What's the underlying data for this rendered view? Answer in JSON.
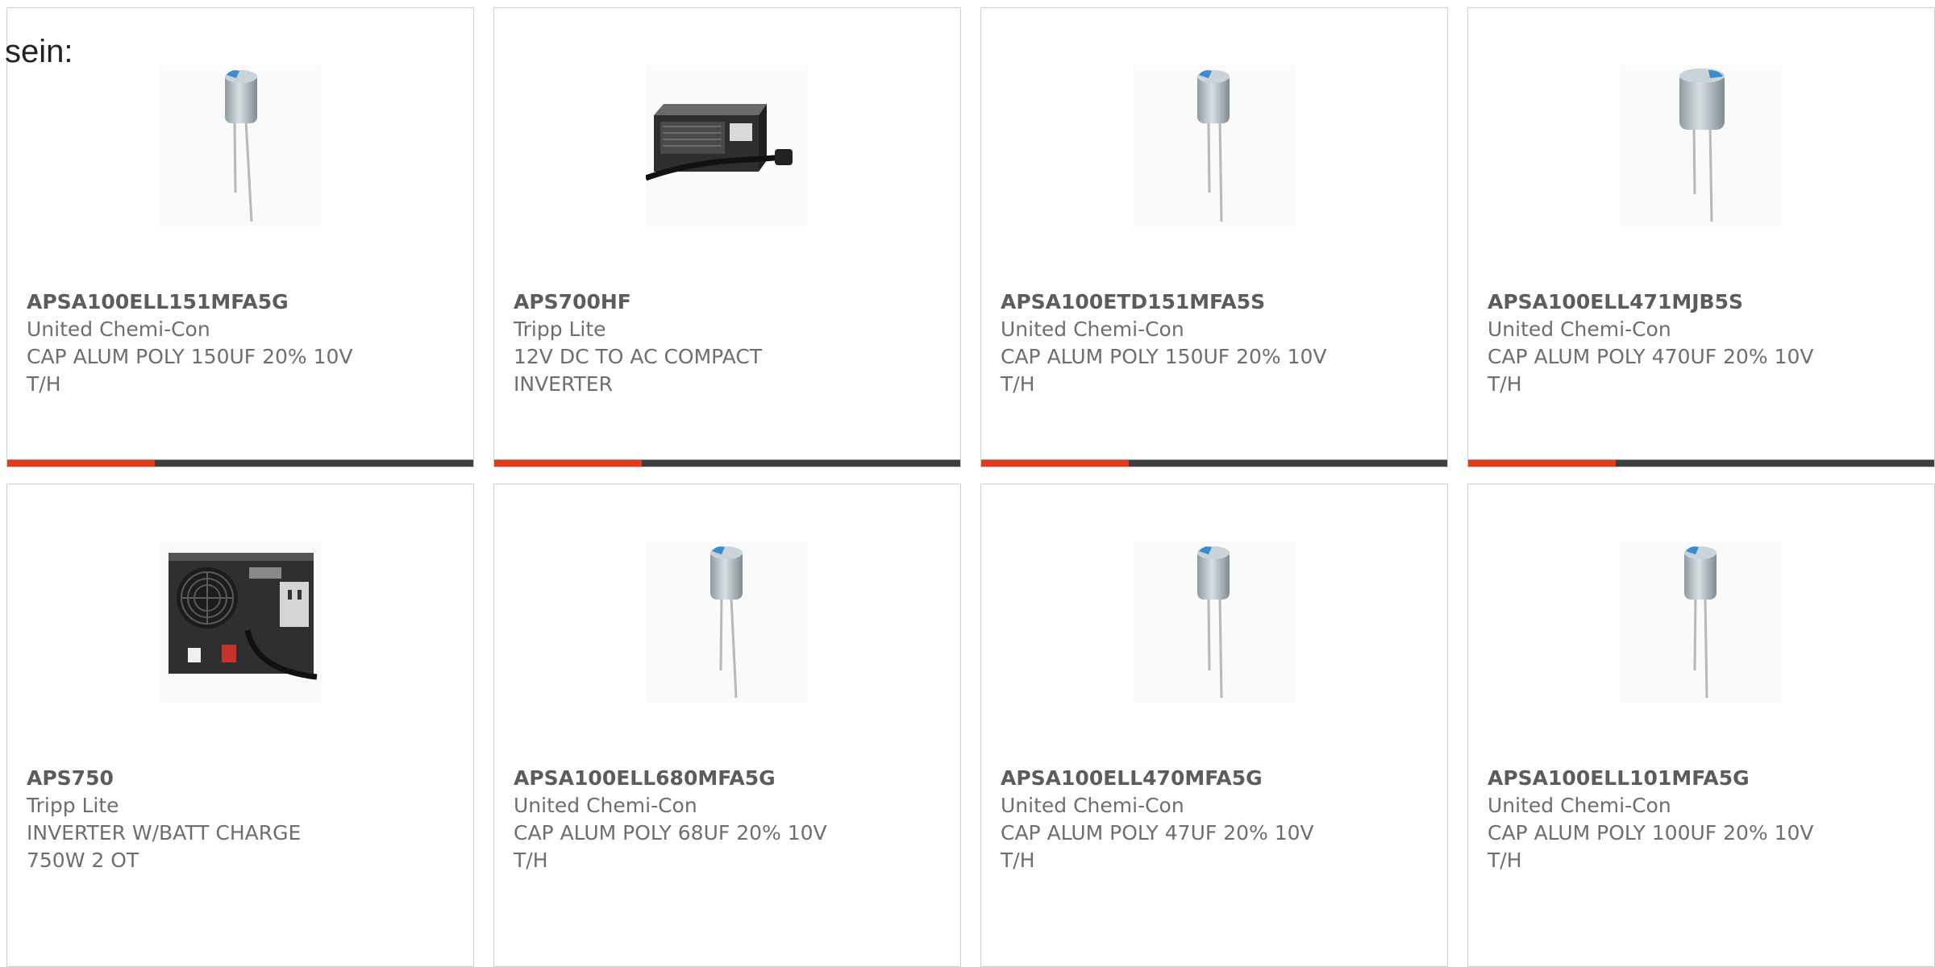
{
  "page": {
    "prefix_text": "sein:"
  },
  "products": [
    {
      "part": "APSA100ELL151MFA5G",
      "maker": "United Chemi-Con",
      "desc1": "CAP ALUM POLY 150UF 20% 10V",
      "desc2": "T/H",
      "image": "capacitor-image"
    },
    {
      "part": "APS700HF",
      "maker": "Tripp Lite",
      "desc1": "12V DC TO AC COMPACT",
      "desc2": "INVERTER",
      "image": "inverter-image"
    },
    {
      "part": "APSA100ETD151MFA5S",
      "maker": "United Chemi-Con",
      "desc1": "CAP ALUM POLY 150UF 20% 10V",
      "desc2": "T/H",
      "image": "capacitor-image"
    },
    {
      "part": "APSA100ELL471MJB5S",
      "maker": "United Chemi-Con",
      "desc1": "CAP ALUM POLY 470UF 20% 10V",
      "desc2": "T/H",
      "image": "capacitor-image"
    },
    {
      "part": "APS750",
      "maker": "Tripp Lite",
      "desc1": "INVERTER W/BATT CHARGE",
      "desc2": "750W 2 OT",
      "image": "inverter-charger-image"
    },
    {
      "part": "APSA100ELL680MFA5G",
      "maker": "United Chemi-Con",
      "desc1": "CAP ALUM POLY 68UF 20% 10V",
      "desc2": "T/H",
      "image": "capacitor-image"
    },
    {
      "part": "APSA100ELL470MFA5G",
      "maker": "United Chemi-Con",
      "desc1": "CAP ALUM POLY 47UF 20% 10V",
      "desc2": "T/H",
      "image": "capacitor-image"
    },
    {
      "part": "APSA100ELL101MFA5G",
      "maker": "United Chemi-Con",
      "desc1": "CAP ALUM POLY 100UF 20% 10V",
      "desc2": "T/H",
      "image": "capacitor-image"
    }
  ],
  "colors": {
    "accent": "#e8381a",
    "bar": "#3f3f3f",
    "border": "#cfcfcf",
    "text": "#6e6e6e"
  }
}
